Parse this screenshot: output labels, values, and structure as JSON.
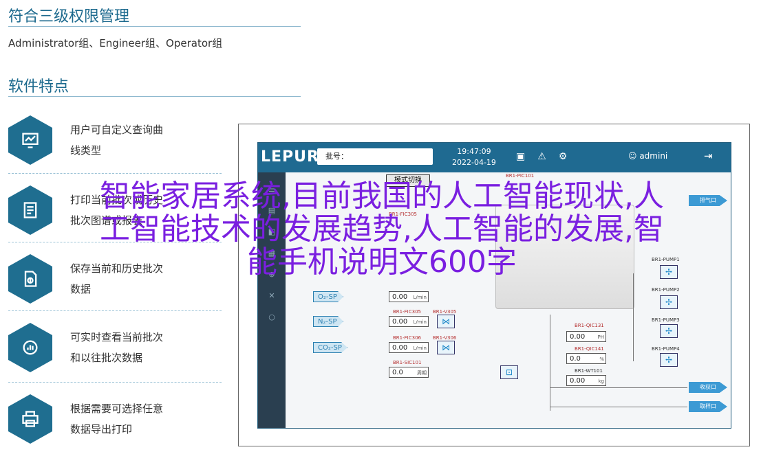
{
  "section1": {
    "title": "符合三级权限管理",
    "desc": "Administrator组、Engineer组、Operator组"
  },
  "section2": {
    "title": "软件特点"
  },
  "features": [
    {
      "line1": "用户可自定义查询曲",
      "line2": "线类型",
      "icon": "chart-icon"
    },
    {
      "line1": "打印当前批次或历史",
      "line2": "批次图谱或报表",
      "icon": "print-report-icon"
    },
    {
      "line1": "保存当前和历史批次",
      "line2": "数据",
      "icon": "file-save-icon"
    },
    {
      "line1": "可实时查看当前批次",
      "line2": "和以往批次数据",
      "icon": "live-chart-icon"
    },
    {
      "line1": "根据需要可选择任意",
      "line2": "数据导出打印",
      "icon": "printer-icon"
    }
  ],
  "hmi": {
    "logo": "LEPURE",
    "batch_label": "批号：",
    "time": "19:47:09",
    "date": "2022-04-19",
    "user": "admini",
    "mode_button": "模式切换",
    "gas": [
      "O₂-SP",
      "N₂-SP",
      "CO₂-SP"
    ],
    "flow_tags": [
      "BR1-FIC305",
      "BR1-FIC306",
      "BR1-SIC101"
    ],
    "valve_tags": [
      "BR1-V305",
      "BR1-V306"
    ],
    "flow_value": "0.00",
    "flow_unit": "L/min",
    "sic_value": "0.0",
    "sic_unit": "周期",
    "pic_tag": "BR1-PIC101",
    "qic_tags": [
      "BR1-QIC131",
      "BR1-QIC141"
    ],
    "qic_values": [
      "0.00",
      "0.0"
    ],
    "qic_units": [
      "PH",
      "%"
    ],
    "wt_tag": "BR1-WT101",
    "wt_value": "0.00",
    "wt_unit": "kg",
    "pumps": [
      "BR1-PUMP1",
      "BR1-PUMP2",
      "BR1-PUMP3",
      "BR1-PUMP4"
    ],
    "out_tags": [
      "收获口",
      "取样口"
    ],
    "exhaust": "排气口"
  },
  "overlay": {
    "line1": "智能家居系统,目前我国的人工智能现状,人",
    "line2": "工智能技术的发展趋势,人工智能的发展,智",
    "line3": "能手机说明文600字"
  }
}
